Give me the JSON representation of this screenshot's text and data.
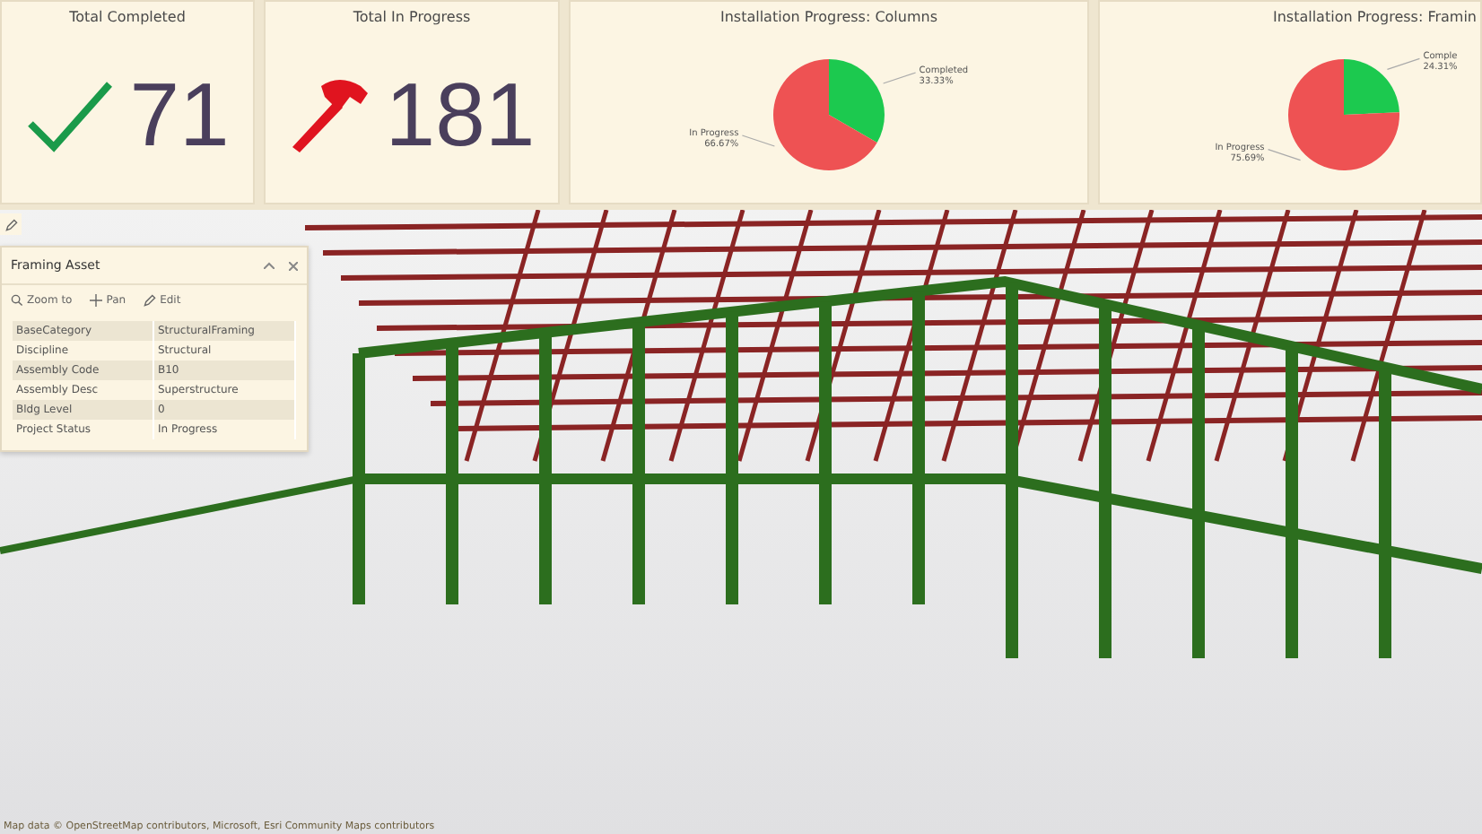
{
  "stats": [
    {
      "title": "Total Completed",
      "value": "71",
      "kind": "completed"
    },
    {
      "title": "Total In Progress",
      "value": "181",
      "kind": "in_progress"
    }
  ],
  "charts": [
    {
      "title": "Installation Progress: Columns",
      "chart_data": {
        "type": "pie",
        "categories": [
          "Completed",
          "In Progress"
        ],
        "values": [
          33.33,
          66.67
        ],
        "colors": [
          "#1cc94f",
          "#ee5253"
        ],
        "value_labels": [
          "33.33%",
          "66.67%"
        ]
      }
    },
    {
      "title": "Installation Progress: Framin",
      "chart_data": {
        "type": "pie",
        "categories": [
          "Comple",
          "In Progress"
        ],
        "values": [
          24.31,
          75.69
        ],
        "colors": [
          "#1cc94f",
          "#ee5253"
        ],
        "value_labels": [
          "24.31%",
          "75.69%"
        ]
      }
    }
  ],
  "popup": {
    "title": "Framing Asset",
    "actions": [
      {
        "label": "Zoom to",
        "kind": "zoom"
      },
      {
        "label": "Pan",
        "kind": "pan"
      },
      {
        "label": "Edit",
        "kind": "edit"
      }
    ],
    "fields": [
      {
        "key": "BaseCategory",
        "value": "StructuralFraming"
      },
      {
        "key": "Discipline",
        "value": "Structural"
      },
      {
        "key": "Assembly Code",
        "value": "B10"
      },
      {
        "key": "Assembly Desc",
        "value": "Superstructure"
      },
      {
        "key": "Bldg Level",
        "value": "0"
      },
      {
        "key": "Project Status",
        "value": "In Progress"
      }
    ]
  },
  "attribution": "Map data © OpenStreetMap contributors, Microsoft, Esri Community Maps contributors"
}
